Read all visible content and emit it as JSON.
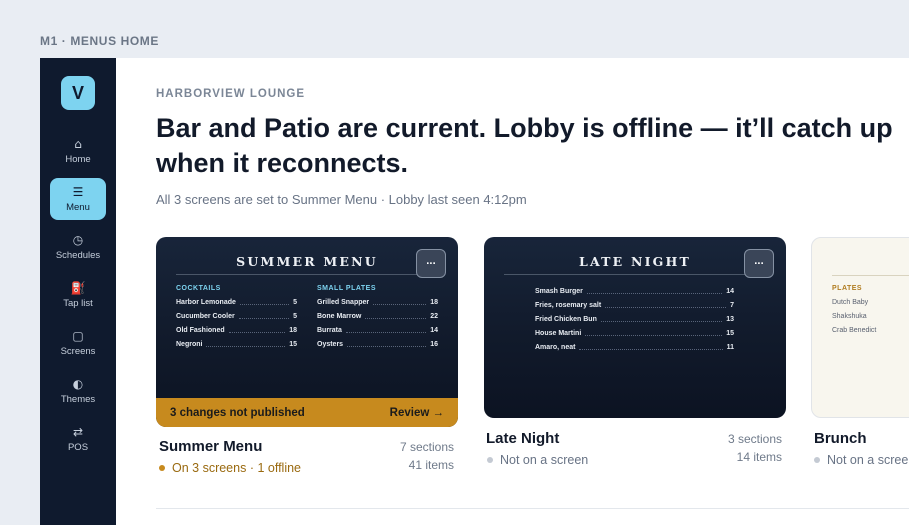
{
  "breadcrumb": "M1 · MENUS HOME",
  "brand": {
    "letter": "V",
    "color": "#7dd3f0"
  },
  "sidebar": {
    "items": [
      {
        "label": "Home",
        "icon": "home-icon",
        "glyph": "⌂",
        "active": false
      },
      {
        "label": "Menu",
        "icon": "menu-icon",
        "glyph": "☰",
        "active": true
      },
      {
        "label": "Schedules",
        "icon": "clock-icon",
        "glyph": "◷",
        "active": false
      },
      {
        "label": "Tap list",
        "icon": "tap-icon",
        "glyph": "⛽",
        "active": false
      },
      {
        "label": "Screens",
        "icon": "screen-icon",
        "glyph": "▢",
        "active": false
      },
      {
        "label": "Themes",
        "icon": "theme-icon",
        "glyph": "◐",
        "active": false
      },
      {
        "label": "POS",
        "icon": "swap-icon",
        "glyph": "⇄",
        "active": false
      }
    ]
  },
  "main": {
    "venue": "HARBORVIEW LOUNGE",
    "headline": "Bar and Patio are current. Lobby is offline — it’ll catch up when it reconnects.",
    "subtitle": "All 3 screens are set to Summer Menu · Lobby last seen 4:12pm"
  },
  "cards": [
    {
      "preview_title": "SUMMER MENU",
      "more_label": "···",
      "columns": [
        {
          "heading": "COCKTAILS",
          "items": [
            {
              "name": "Harbor Lemonade",
              "price": "5"
            },
            {
              "name": "Cucumber Cooler",
              "price": "5"
            },
            {
              "name": "Old Fashioned",
              "price": "18"
            },
            {
              "name": "Negroni",
              "price": "15"
            }
          ]
        },
        {
          "heading": "SMALL PLATES",
          "items": [
            {
              "name": "Grilled Snapper",
              "price": "18"
            },
            {
              "name": "Bone Marrow",
              "price": "22"
            },
            {
              "name": "Burrata",
              "price": "14"
            },
            {
              "name": "Oysters",
              "price": "16"
            }
          ]
        }
      ],
      "banner": {
        "text": "3 changes not published",
        "action": "Review →",
        "color": "#c78a1e"
      },
      "name": "Summer Menu",
      "status": "On 3 screens · 1 offline",
      "status_color": "#9a6a10",
      "sections": "7 sections",
      "items_count": "41 items"
    },
    {
      "preview_title": "LATE NIGHT",
      "more_label": "···",
      "columns": [
        {
          "heading": "",
          "items": [
            {
              "name": "Smash Burger",
              "price": "14"
            },
            {
              "name": "Fries, rosemary salt",
              "price": "7"
            },
            {
              "name": "Fried Chicken Bun",
              "price": "13"
            },
            {
              "name": "House Martini",
              "price": "15"
            },
            {
              "name": "Amaro, neat",
              "price": "11"
            }
          ]
        }
      ],
      "name": "Late Night",
      "status": "Not on a screen",
      "status_color": "#687385",
      "sections": "3 sections",
      "items_count": "14 items"
    },
    {
      "columns": [
        {
          "heading": "PLATES",
          "items": [
            {
              "name": "Dutch Baby",
              "price": ""
            },
            {
              "name": "Shakshuka",
              "price": ""
            },
            {
              "name": "Crab Benedict",
              "price": ""
            }
          ]
        }
      ],
      "name": "Brunch",
      "status": "Not on a screen",
      "status_color": "#687385"
    }
  ]
}
